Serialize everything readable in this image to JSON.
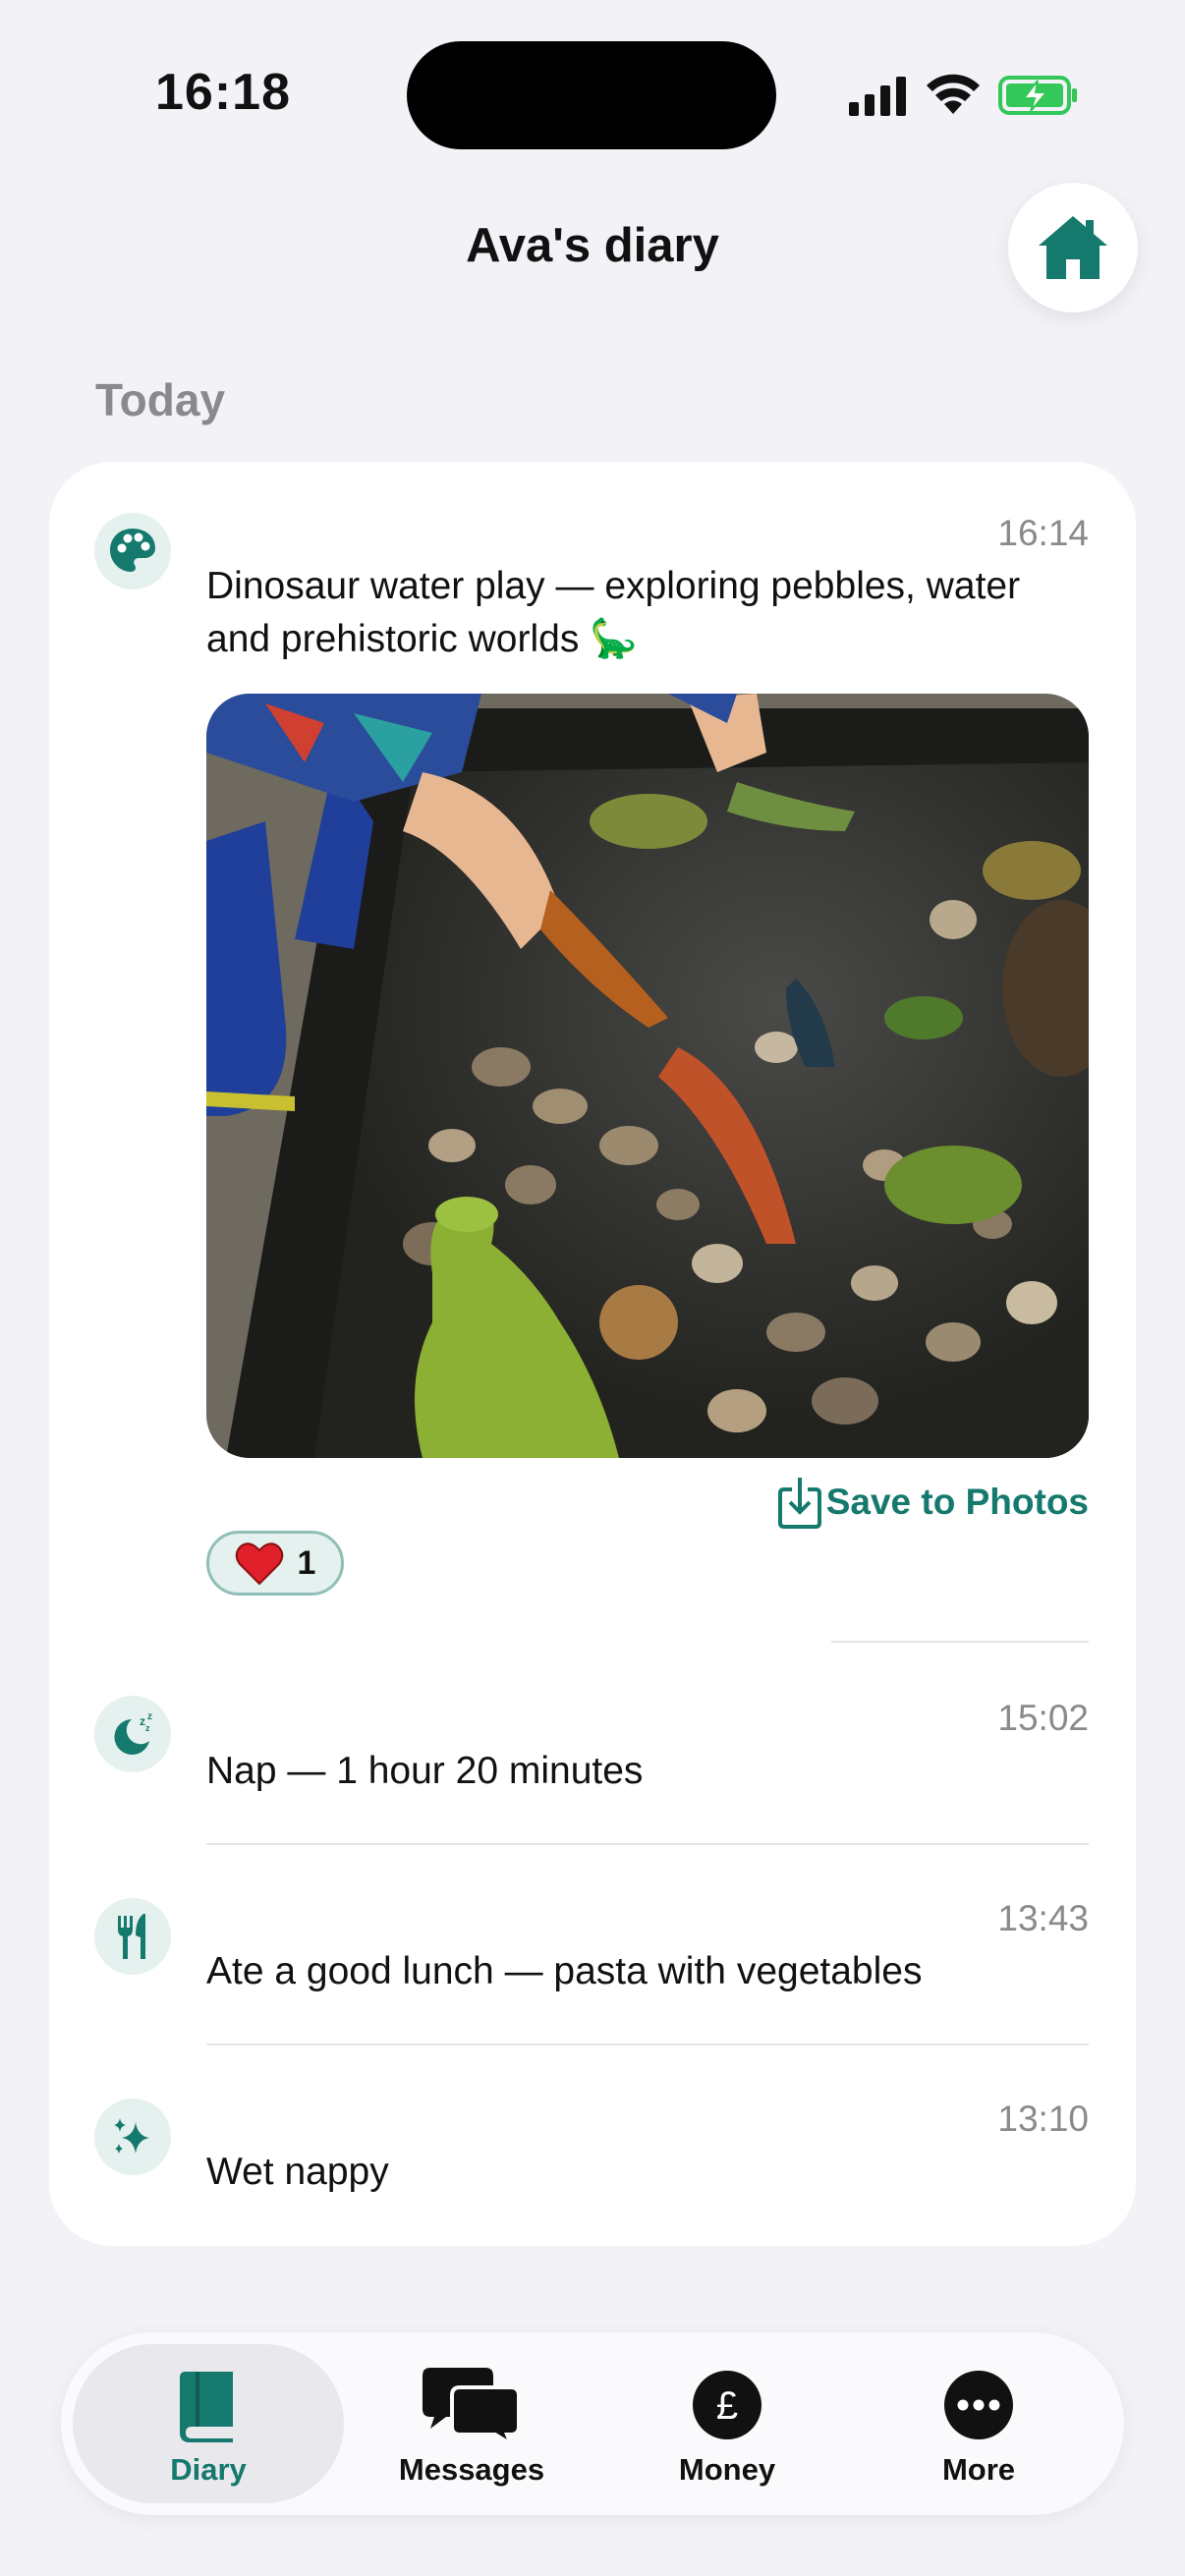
{
  "status_bar": {
    "time": "16:18"
  },
  "header": {
    "title": "Ava's diary",
    "home_icon": "home-icon"
  },
  "section": {
    "label": "Today"
  },
  "entries": [
    {
      "time": "16:14",
      "icon": "palette-icon",
      "text": "Dinosaur water play — exploring pebbles, water and prehistoric worlds 🦕",
      "photo_description_icon": "photo",
      "save_label": "Save to Photos",
      "reaction": {
        "emoji": "❤️",
        "count": "1"
      }
    },
    {
      "time": "15:02",
      "icon": "moon-sleep-icon",
      "text": "Nap — 1 hour 20 minutes"
    },
    {
      "time": "13:43",
      "icon": "fork-knife-icon",
      "text": "Ate a good lunch — pasta with vegetables"
    },
    {
      "time": "13:10",
      "icon": "sparkles-icon",
      "text": "Wet nappy"
    }
  ],
  "tabs": [
    {
      "label": "Diary",
      "icon": "book-icon",
      "active": true
    },
    {
      "label": "Messages",
      "icon": "chat-bubbles-icon",
      "active": false
    },
    {
      "label": "Money",
      "icon": "pound-icon",
      "active": false
    },
    {
      "label": "More",
      "icon": "ellipsis-icon",
      "active": false
    }
  ],
  "colors": {
    "accent": "#15796d",
    "background": "#f2f2f7",
    "icon_bg": "#e4f1ee"
  }
}
